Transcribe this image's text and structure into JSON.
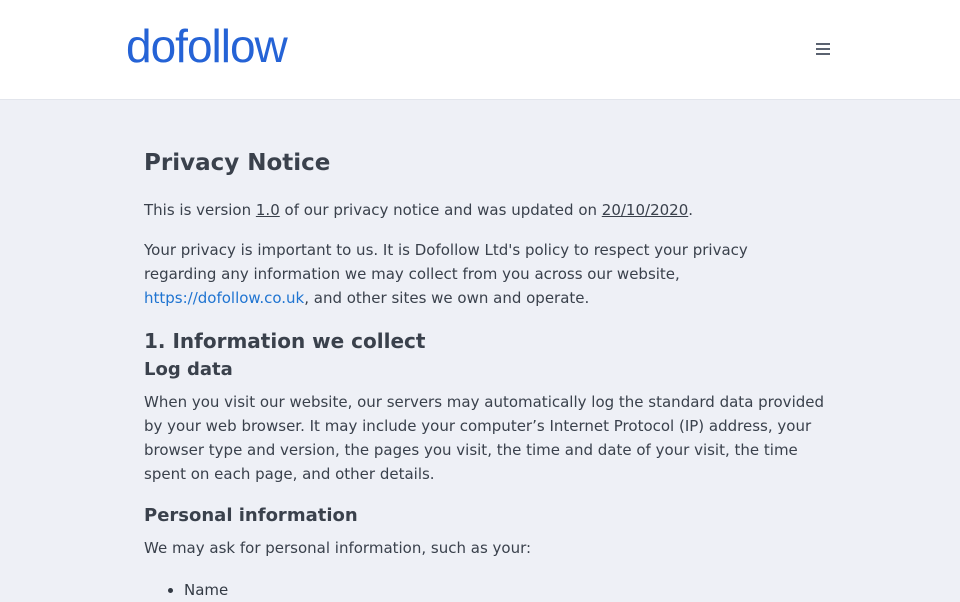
{
  "header": {
    "logo_text": "dofollow",
    "menu_icon": "hamburger-menu-icon"
  },
  "colors": {
    "brand_blue": "#2563d6",
    "link_blue": "#1f74d1",
    "page_bg": "#eef0f6"
  },
  "page": {
    "title": "Privacy Notice",
    "version_prefix": "This is version ",
    "version": "1.0",
    "version_middle": " of our privacy notice and was updated on ",
    "updated_date": "20/10/2020",
    "version_suffix": ".",
    "intro_prefix": "Your privacy is important to us. It is Dofollow Ltd's policy to respect your privacy regarding any information we may collect from you across our website, ",
    "intro_link": "https://dofollow.co.uk",
    "intro_suffix": ", and other sites we own and operate.",
    "section1_heading": "1. Information we collect",
    "log_heading": "Log data",
    "log_text": "When you visit our website, our servers may automatically log the standard data provided by your web browser. It may include your computer’s Internet Protocol (IP) address, your browser type and version, the pages you visit, the time and date of your visit, the time spent on each page, and other details.",
    "personal_heading": "Personal information",
    "personal_text": "We may ask for personal information, such as your:",
    "personal_items": [
      "Name"
    ]
  }
}
